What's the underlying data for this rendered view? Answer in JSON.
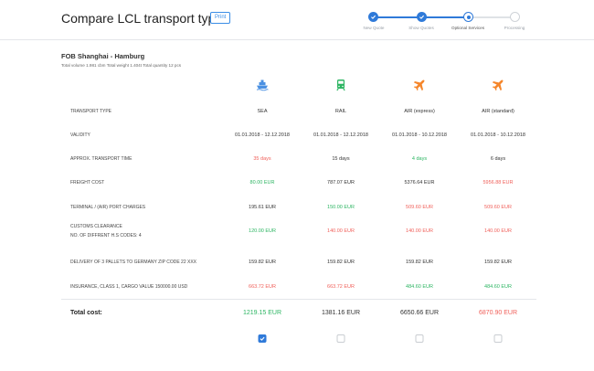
{
  "header": {
    "title": "Compare LCL transport types",
    "print_label": "Print"
  },
  "stepper": {
    "steps": [
      {
        "label": "New Quote",
        "state": "done"
      },
      {
        "label": "Show Quotes",
        "state": "done"
      },
      {
        "label": "Optional Services",
        "state": "current"
      },
      {
        "label": "Processing",
        "state": "todo"
      }
    ],
    "accent": "#2f7ad9"
  },
  "shipment": {
    "route": "FOB Shanghai - Hamburg",
    "totals": "Total volume 1.981 cbm Total weight 1.404t Total quantity 12 pcs"
  },
  "columns": [
    {
      "icon": "ship-icon",
      "icon_color": "#4a90e2"
    },
    {
      "icon": "train-icon",
      "icon_color": "#2cb562"
    },
    {
      "icon": "airplane-icon",
      "icon_color": "#f5862b"
    },
    {
      "icon": "airplane-icon",
      "icon_color": "#f5862b"
    }
  ],
  "rows": [
    {
      "label": "TRANSPORT TYPE",
      "cells": [
        {
          "text": "SEA",
          "tone": "normal"
        },
        {
          "text": "RAIL",
          "tone": "normal"
        },
        {
          "text": "AIR (express)",
          "tone": "normal"
        },
        {
          "text": "AIR (standard)",
          "tone": "normal"
        }
      ]
    },
    {
      "label": "VALIDITY",
      "cells": [
        {
          "text": "01.01.2018 - 12.12.2018",
          "tone": "normal"
        },
        {
          "text": "01.01.2018 - 12.12.2018",
          "tone": "normal"
        },
        {
          "text": "01.01.2018 - 10.12.2018",
          "tone": "normal"
        },
        {
          "text": "01.01.2018 - 10.12.2018",
          "tone": "normal"
        }
      ]
    },
    {
      "label": "APPROX. TRANSPORT TIME",
      "cells": [
        {
          "text": "35 days",
          "tone": "red"
        },
        {
          "text": "15 days",
          "tone": "normal"
        },
        {
          "text": "4 days",
          "tone": "green"
        },
        {
          "text": "6 days",
          "tone": "normal"
        }
      ]
    },
    {
      "label": "FREIGHT COST",
      "cells": [
        {
          "text": "80.00 EUR",
          "tone": "green"
        },
        {
          "text": "787.07 EUR",
          "tone": "normal"
        },
        {
          "text": "5376.64 EUR",
          "tone": "normal"
        },
        {
          "text": "5956.88 EUR",
          "tone": "red"
        }
      ]
    },
    {
      "label": "TERMINAL / (AIR) PORT CHARGES",
      "cells": [
        {
          "text": "195.61 EUR",
          "tone": "normal"
        },
        {
          "text": "150.00 EUR",
          "tone": "green"
        },
        {
          "text": "509.60 EUR",
          "tone": "red"
        },
        {
          "text": "509.60 EUR",
          "tone": "red"
        }
      ]
    },
    {
      "label": "CUSTOMS CLEARANCE",
      "sub": "NO. OF DIFFRENT H.S CODES: 4",
      "cells": [
        {
          "text": "120.00 EUR",
          "tone": "green"
        },
        {
          "text": "140.00 EUR",
          "tone": "red"
        },
        {
          "text": "140.00 EUR",
          "tone": "red"
        },
        {
          "text": "140.00 EUR",
          "tone": "red"
        }
      ]
    },
    {
      "label": "DELIVERY OF 3 PALLETS TO GERMANY ZIP CODE 22 XXX",
      "cells": [
        {
          "text": "159.82 EUR",
          "tone": "normal"
        },
        {
          "text": "159.82 EUR",
          "tone": "normal"
        },
        {
          "text": "159.82 EUR",
          "tone": "normal"
        },
        {
          "text": "159.82 EUR",
          "tone": "normal"
        }
      ]
    },
    {
      "label": "INSURANCE, CLASS 1, CARGO VALUE 150000.00 USD",
      "cells": [
        {
          "text": "663.72 EUR",
          "tone": "red"
        },
        {
          "text": "663.72 EUR",
          "tone": "red"
        },
        {
          "text": "484.60 EUR",
          "tone": "green"
        },
        {
          "text": "484.60 EUR",
          "tone": "green"
        }
      ]
    }
  ],
  "total": {
    "label": "Total cost:",
    "cells": [
      {
        "text": "1219.15 EUR",
        "tone": "green"
      },
      {
        "text": "1381.16 EUR",
        "tone": "normal"
      },
      {
        "text": "6650.66 EUR",
        "tone": "normal"
      },
      {
        "text": "6870.90 EUR",
        "tone": "red"
      }
    ]
  },
  "selection": [
    true,
    false,
    false,
    false
  ],
  "colors": {
    "red": "#f0605a",
    "green": "#2cb562",
    "blue": "#2f7ad9",
    "orange": "#f5862b"
  }
}
